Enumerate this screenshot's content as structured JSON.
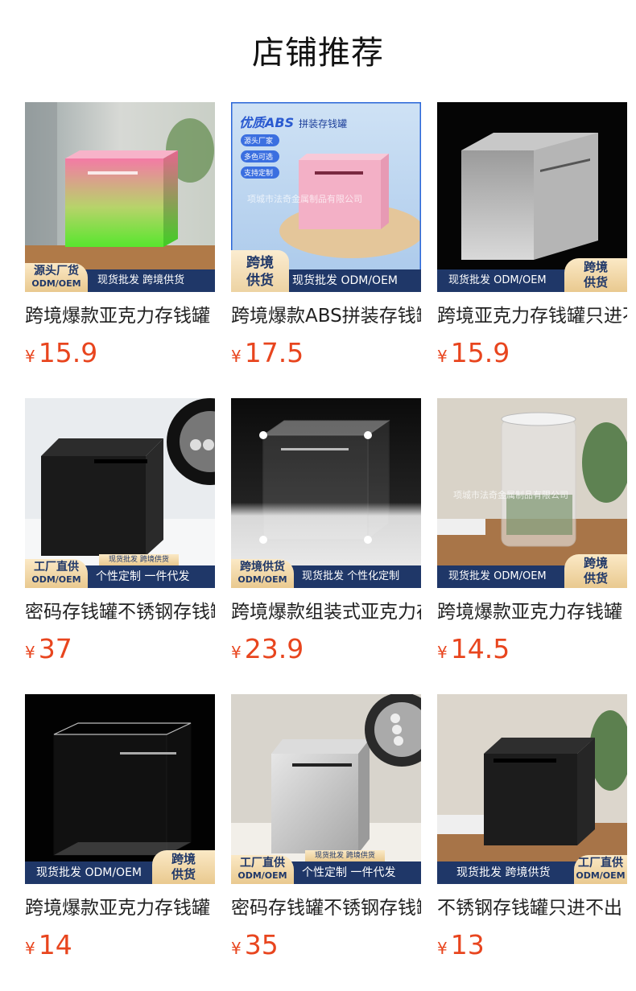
{
  "page": {
    "title": "店铺推荐"
  },
  "colors": {
    "price": "#e8451e",
    "banner": "#1f3768",
    "gold": "#e9c98f"
  },
  "products": [
    {
      "name": "跨境爆款亚克力存钱罐",
      "price_symbol": "¥",
      "price": "15.9",
      "image": "gradient-pink-green-cube",
      "banner": {
        "tag_main": "源头厂货",
        "tag_sub": "ODM/OEM",
        "text": "现货批发 跨境供货"
      }
    },
    {
      "name": "跨境爆款ABS拼装存钱罐",
      "price_symbol": "¥",
      "price": "17.5",
      "image": "pink-abs-cube",
      "promo": {
        "head": "优质ABS",
        "head_sub": "拼装存钱罐",
        "items": [
          "源头厂家",
          "多色可选",
          "支持定制"
        ],
        "watermark": "项城市法奇金属制品有限公司"
      },
      "banner": {
        "tag_main": "跨境",
        "tag_main2": "供货",
        "text": "现货批发 ODM/OEM"
      }
    },
    {
      "name": "跨境亚克力存钱罐只进不出",
      "price_symbol": "¥",
      "price": "15.9",
      "image": "frosted-cube",
      "banner": {
        "text": "现货批发 ODM/OEM",
        "tag_main": "跨境",
        "tag_main2": "供货"
      }
    },
    {
      "name": "密码存钱罐不锈钢存钱罐",
      "price_symbol": "¥",
      "price": "37",
      "image": "black-lock-cube",
      "banner": {
        "tag_main": "工厂直供",
        "tag_sub": "ODM/OEM",
        "top": "现货批发 跨境供货",
        "text": "个性定制 一件代发"
      }
    },
    {
      "name": "跨境爆款组装式亚克力存钱罐",
      "price_symbol": "¥",
      "price": "23.9",
      "image": "clear-assembled-cube",
      "banner": {
        "tag_main": "跨境供货",
        "tag_sub": "ODM/OEM",
        "text": "现货批发 个性化定制"
      }
    },
    {
      "name": "跨境爆款亚克力存钱罐",
      "price_symbol": "¥",
      "price": "14.5",
      "image": "clear-cylinder",
      "watermark": "项城市法奇金属制品有限公司",
      "banner": {
        "text": "现货批发 ODM/OEM",
        "tag_main": "跨境",
        "tag_main2": "供货"
      }
    },
    {
      "name": "跨境爆款亚克力存钱罐",
      "price_symbol": "¥",
      "price": "14",
      "image": "clear-cube-black-bg",
      "banner": {
        "text": "现货批发 ODM/OEM",
        "tag_main": "跨境",
        "tag_main2": "供货"
      }
    },
    {
      "name": "密码存钱罐不锈钢存钱罐",
      "price_symbol": "¥",
      "price": "35",
      "image": "silver-lock-cube",
      "banner": {
        "tag_main": "工厂直供",
        "tag_sub": "ODM/OEM",
        "top": "现货批发 跨境供货",
        "text": "个性定制 一件代发"
      }
    },
    {
      "name": "不锈钢存钱罐只进不出",
      "price_symbol": "¥",
      "price": "13",
      "image": "black-steel-cube",
      "banner": {
        "text": "现货批发 跨境供货",
        "tag_main": "工厂直供",
        "tag_sub": "ODM/OEM"
      }
    }
  ]
}
